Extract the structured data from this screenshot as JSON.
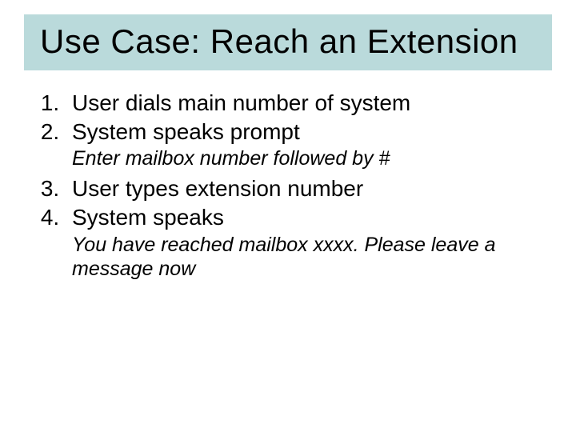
{
  "title": "Use Case: Reach an Extension",
  "steps": {
    "s1": "User dials main number of system",
    "s2": "System speaks prompt",
    "s2_sub": "Enter mailbox number followed by #",
    "s3": "User types extension number",
    "s4": "System speaks",
    "s4_sub": "You have reached mailbox xxxx. Please leave a message now"
  }
}
